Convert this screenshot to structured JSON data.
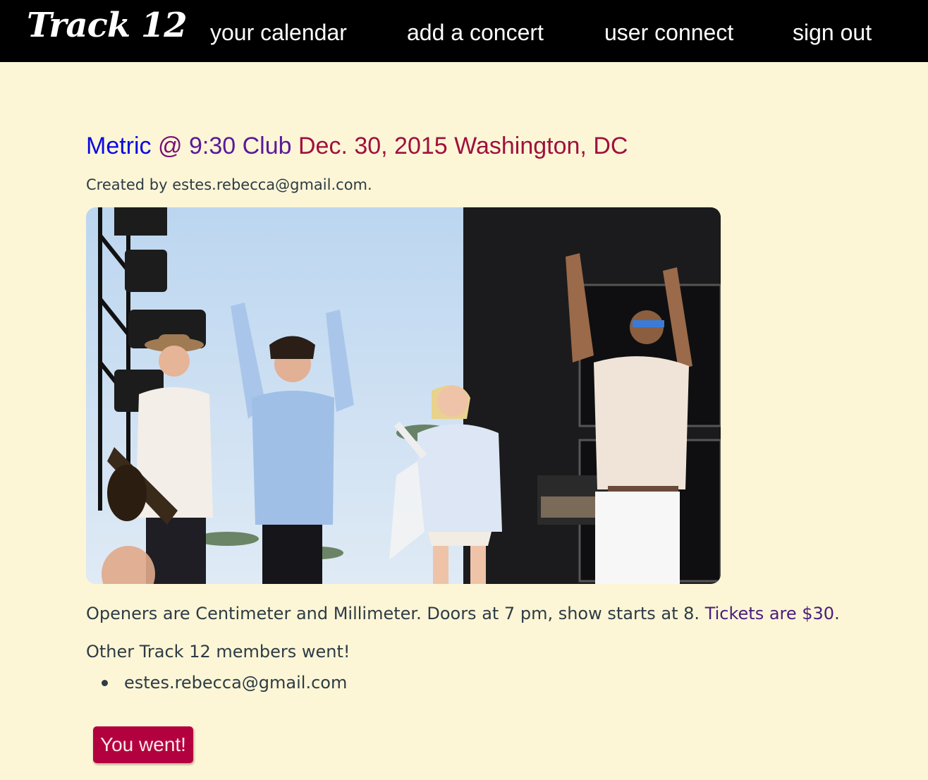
{
  "nav": {
    "brand": "Track 12",
    "links": [
      "your calendar",
      "add a concert",
      "user connect",
      "sign out"
    ]
  },
  "concert": {
    "artist": "Metric",
    "at": "@",
    "venue": "9:30 Club",
    "date": "Dec. 30, 2015",
    "location": "Washington, DC",
    "created_by": "Created by estes.rebecca@gmail.com.",
    "description": "Openers are Centimeter and Millimeter. Doors at 7 pm, show starts at 8.",
    "tickets": "Tickets are $30",
    "tickets_suffix": "."
  },
  "members": {
    "heading": "Other Track 12 members went!",
    "list": [
      "estes.rebecca@gmail.com"
    ]
  },
  "actions": {
    "went_label": "You went!"
  },
  "colors": {
    "background": "#fcf6d6",
    "navbar": "#000000",
    "artist": "#0a0ae0",
    "at": "#7a0f7a",
    "venue": "#5a1a9a",
    "date": "#a0103e",
    "location": "#a0103e",
    "button": "#b3003f",
    "text": "#2e3b45"
  }
}
